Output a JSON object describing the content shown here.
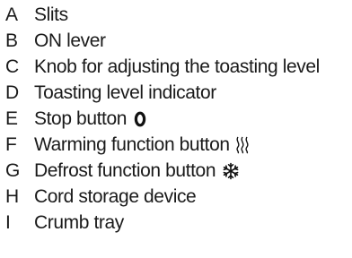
{
  "items": [
    {
      "letter": "A",
      "label": "Slits"
    },
    {
      "letter": "B",
      "label": "ON lever"
    },
    {
      "letter": "C",
      "label": "Knob for adjusting the toasting level"
    },
    {
      "letter": "D",
      "label": "Toasting level indicator"
    },
    {
      "letter": "E",
      "label": "Stop button",
      "icon": "stop-icon"
    },
    {
      "letter": "F",
      "label": "Warming function button",
      "icon": "warming-icon"
    },
    {
      "letter": "G",
      "label": "Defrost function button",
      "icon": "snowflake-icon"
    },
    {
      "letter": "H",
      "label": "Cord storage device"
    },
    {
      "letter": "I",
      "label": "Crumb tray"
    }
  ]
}
